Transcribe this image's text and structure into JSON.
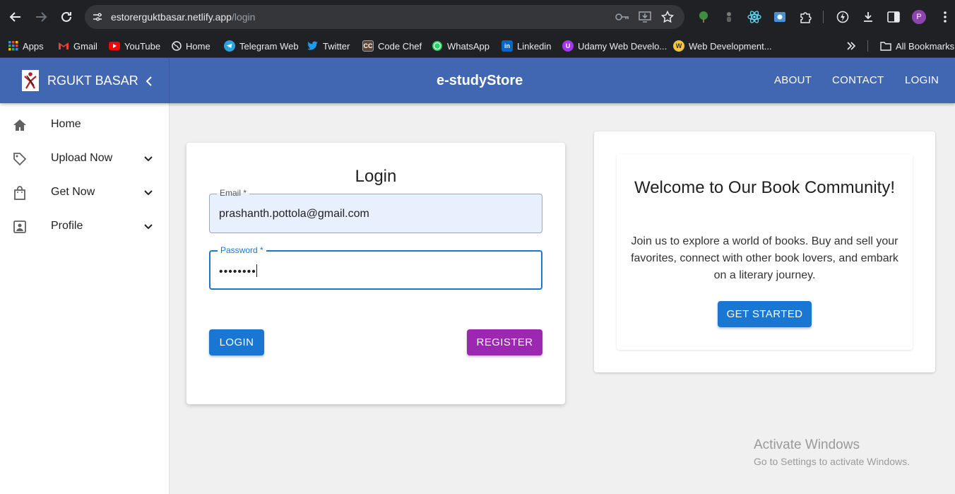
{
  "browser": {
    "url_host": "estorerguktbasar.netlify.app",
    "url_path": "/login",
    "profile_initial": "P",
    "bookmarks": [
      {
        "label": "Apps",
        "icon": "apps-grid-icon",
        "color": "#4285f4"
      },
      {
        "label": "Gmail",
        "icon": "gmail-icon",
        "color": "#ea4335"
      },
      {
        "label": "YouTube",
        "icon": "youtube-icon",
        "color": "#ff0000"
      },
      {
        "label": "Home",
        "icon": "globe-icon",
        "color": "#9aa0a6"
      },
      {
        "label": "Telegram Web",
        "icon": "telegram-icon",
        "color": "#2aa3df"
      },
      {
        "label": "Twitter",
        "icon": "twitter-icon",
        "color": "#1d9bf0"
      },
      {
        "label": "Code Chef",
        "icon": "codechef-icon",
        "color": "#6b4a3a"
      },
      {
        "label": "WhatsApp",
        "icon": "whatsapp-icon",
        "color": "#25d366"
      },
      {
        "label": "Linkedin",
        "icon": "linkedin-icon",
        "color": "#0a66c2"
      },
      {
        "label": "Udamy Web Develo...",
        "icon": "udemy-icon",
        "color": "#a435f0"
      },
      {
        "label": "Web Development...",
        "icon": "web-dev-icon",
        "color": "#f5c542"
      }
    ],
    "all_bookmarks": "All Bookmarks"
  },
  "app": {
    "brand": "RGUKT BASAR",
    "site_title": "e-studyStore",
    "nav": {
      "about": "ABOUT",
      "contact": "CONTACT",
      "login": "LOGIN"
    },
    "colors": {
      "primary": "#4267b2",
      "button_blue": "#1976d2",
      "button_purple": "#9c27b0"
    }
  },
  "sidebar": {
    "items": [
      {
        "label": "Home",
        "icon": "home-icon"
      },
      {
        "label": "Upload Now",
        "icon": "tag-icon"
      },
      {
        "label": "Get Now",
        "icon": "shopping-bag-icon"
      },
      {
        "label": "Profile",
        "icon": "profile-icon"
      }
    ]
  },
  "login": {
    "title": "Login",
    "email_label": "Email *",
    "email_value": "prashanth.pottola@gmail.com",
    "password_label": "Password *",
    "password_value": "••••••••",
    "login_button": "LOGIN",
    "register_button": "REGISTER"
  },
  "welcome": {
    "title": "Welcome to Our Book Community!",
    "text": "Join us to explore a world of books. Buy and sell your favorites, connect with other book lovers, and embark on a literary journey.",
    "button": "GET STARTED"
  },
  "watermark": {
    "line1": "Activate Windows",
    "line2": "Go to Settings to activate Windows."
  }
}
